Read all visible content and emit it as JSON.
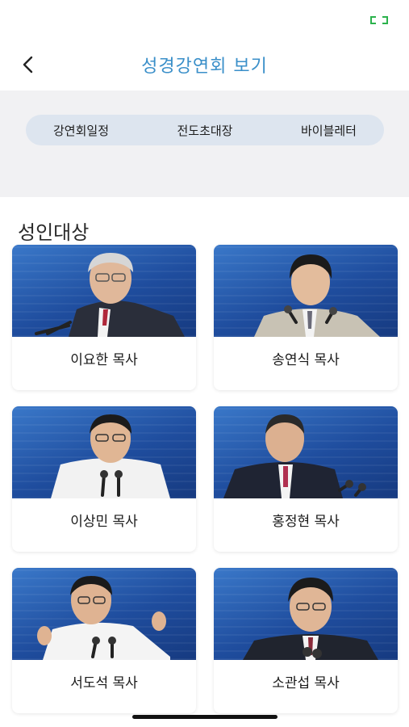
{
  "status": {
    "icon": "fullscreen-icon",
    "accent": "#2bb24c"
  },
  "nav": {
    "title": "성경강연회 보기",
    "back_icon": "chevron-left-icon"
  },
  "tabs": [
    {
      "label": "강연회일정"
    },
    {
      "label": "전도초대장"
    },
    {
      "label": "바이블레터"
    }
  ],
  "section": {
    "title": "성인대상"
  },
  "speakers": [
    {
      "name": "이요한 목사"
    },
    {
      "name": "송연식 목사"
    },
    {
      "name": "이상민 목사"
    },
    {
      "name": "홍정현 목사"
    },
    {
      "name": "서도석 목사"
    },
    {
      "name": "소관섭 목사"
    }
  ]
}
